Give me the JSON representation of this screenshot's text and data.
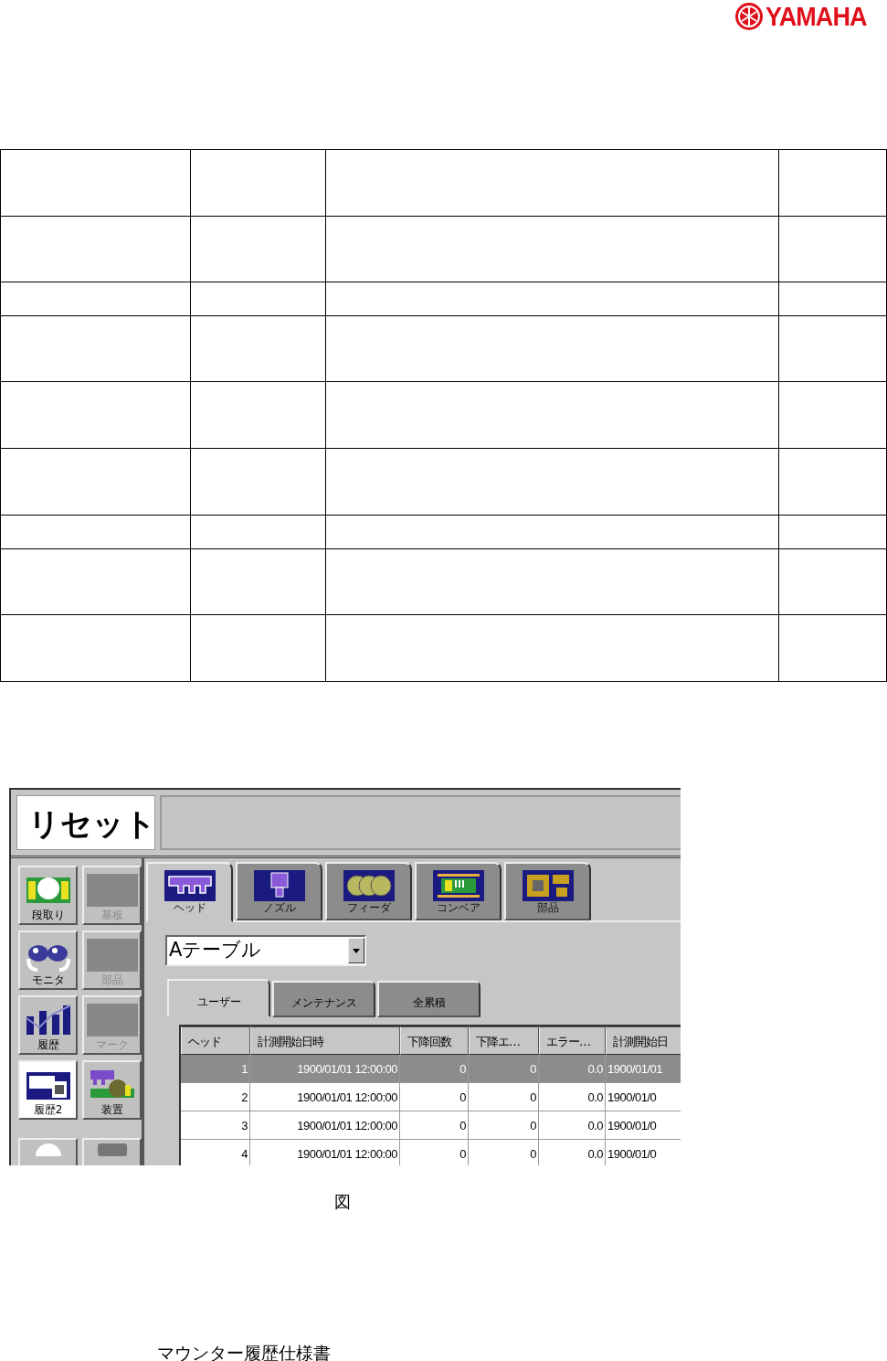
{
  "header": {
    "logo_text": "YAMAHA"
  },
  "app": {
    "title": "リセット",
    "sidebar": [
      {
        "kind": "setup",
        "label": "段取り",
        "disabled": false,
        "selected": false
      },
      {
        "kind": "board",
        "label": "基板",
        "disabled": true,
        "selected": false
      },
      {
        "kind": "monitor",
        "label": "モニタ",
        "disabled": false,
        "selected": false
      },
      {
        "kind": "parts",
        "label": "部品",
        "disabled": true,
        "selected": false
      },
      {
        "kind": "history",
        "label": "履歴",
        "disabled": false,
        "selected": false
      },
      {
        "kind": "mark",
        "label": "マーク",
        "disabled": true,
        "selected": false
      },
      {
        "kind": "history2",
        "label": "履歴2",
        "disabled": false,
        "selected": true
      },
      {
        "kind": "device",
        "label": "装置",
        "disabled": false,
        "selected": false
      },
      {
        "kind": "circle",
        "disabled": false,
        "selected": false
      },
      {
        "kind": "square",
        "disabled": false,
        "selected": false
      }
    ],
    "tabs": [
      {
        "kind": "head",
        "label": "ヘッド",
        "selected": true
      },
      {
        "kind": "nozzle",
        "label": "ノズル",
        "selected": false
      },
      {
        "kind": "feeder",
        "label": "フィーダ",
        "selected": false
      },
      {
        "kind": "conveyor",
        "label": "コンベア",
        "selected": false
      },
      {
        "kind": "part",
        "label": "部品",
        "selected": false
      }
    ],
    "dropdown": {
      "value": "Aテーブル"
    },
    "subtabs": [
      {
        "label": "ユーザー",
        "selected": true
      },
      {
        "label": "メンテナンス",
        "selected": false
      },
      {
        "label": "全累積",
        "selected": false
      }
    ],
    "table": {
      "columns": [
        "ヘッド",
        "計測開始日時",
        "下降回数",
        "下降エ…",
        "エラー…",
        "計測開始日"
      ],
      "rows": [
        {
          "selected": true,
          "cells": [
            "1",
            "1900/01/01 12:00:00",
            "0",
            "0",
            "0.0",
            "1900/01/01"
          ]
        },
        {
          "selected": false,
          "cells": [
            "2",
            "1900/01/01 12:00:00",
            "0",
            "0",
            "0.0",
            "1900/01/0"
          ]
        },
        {
          "selected": false,
          "cells": [
            "3",
            "1900/01/01 12:00:00",
            "0",
            "0",
            "0.0",
            "1900/01/0"
          ]
        },
        {
          "selected": false,
          "cells": [
            "4",
            "1900/01/01 12:00:00",
            "0",
            "0",
            "0.0",
            "1900/01/0"
          ]
        }
      ]
    }
  },
  "caption": "図",
  "footer": "マウンター履歴仕様書"
}
